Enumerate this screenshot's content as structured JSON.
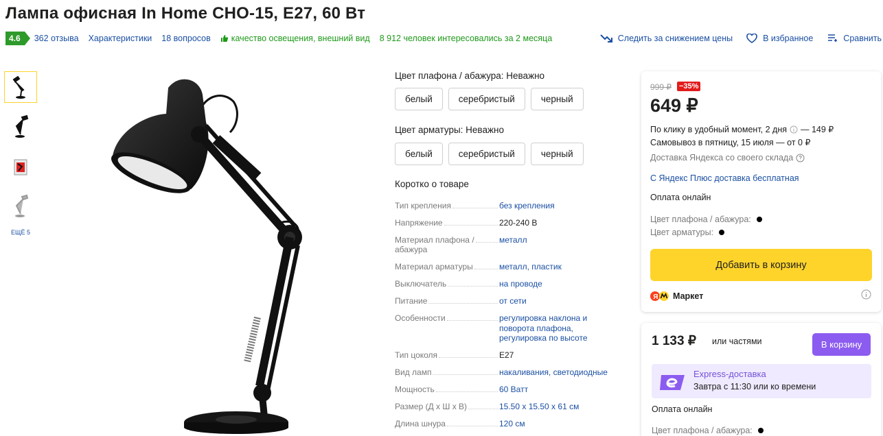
{
  "title": "Лампа офисная In Home CHO-15, E27, 60 Вт",
  "meta": {
    "rating": "4.6",
    "reviews": "362 отзыва",
    "specs_link": "Характеристики",
    "questions": "18 вопросов",
    "quality": "качество освещения, внешний вид",
    "interest": "8 912 человек интересовались за 2 месяца",
    "track_price": "Следить за снижением цены",
    "favorite": "В избранное",
    "compare": "Сравнить"
  },
  "gallery": {
    "more": "ЕЩЁ 5"
  },
  "options": {
    "shade_label": "Цвет плафона / абажура:",
    "shade_value": "Неважно",
    "shade_chips": [
      "белый",
      "серебристый",
      "черный"
    ],
    "arm_label": "Цвет арматуры:",
    "arm_value": "Неважно",
    "arm_chips": [
      "белый",
      "серебристый",
      "черный"
    ]
  },
  "specs": {
    "title": "Коротко о товаре",
    "rows": [
      {
        "key": "Тип крепления",
        "value": "без крепления"
      },
      {
        "key": "Напряжение",
        "value": "220-240 В"
      },
      {
        "key": "Материал плафона / абажура",
        "value": "металл"
      },
      {
        "key": "Материал арматуры",
        "value": "металл, пластик"
      },
      {
        "key": "Выключатель",
        "value": "на проводе"
      },
      {
        "key": "Питание",
        "value": "от сети"
      },
      {
        "key": "Особенности",
        "value": "регулировка наклона и поворота плафона, регулировка по высоте"
      },
      {
        "key": "Тип цоколя",
        "value": "E27"
      },
      {
        "key": "Вид ламп",
        "value": "накаливания, светодиодные"
      },
      {
        "key": "Мощность",
        "value": "60 Ватт"
      },
      {
        "key": "Размер (Д х Ш х В)",
        "value": "15.50 х 15.50 х 61 см"
      },
      {
        "key": "Длина шнура",
        "value": "120 см"
      }
    ]
  },
  "offer1": {
    "old_price": "999 ₽",
    "discount": "−35%",
    "price": "649 ₽",
    "delivery1": "По клику в удобный момент, 2 дня",
    "delivery1_price": "— 149 ₽",
    "pickup": "Самовывоз в пятницу, 15 июля — от 0 ₽",
    "yandex_delivery": "Доставка Яндекса со своего склада",
    "plus": "С Яндекс Плюс доставка бесплатная",
    "payment": "Оплата онлайн",
    "shade_color": "Цвет плафона / абажура:",
    "arm_color": "Цвет арматуры:",
    "add_to_cart": "Добавить в корзину",
    "seller": "Маркет"
  },
  "offer2": {
    "price": "1 133 ₽",
    "parts": "или частями",
    "buy": "В корзину",
    "express_title": "Express-доставка",
    "express_sub": "Завтра с 11:30 или ко времени",
    "payment": "Оплата онлайн",
    "shade_color": "Цвет плафона / абажура:"
  },
  "colors": {
    "rating_green": "#2e9a2a",
    "link_blue": "#1a4fa3",
    "yellow": "#fed42b",
    "purple": "#8c5cf0",
    "discount_red": "#e21b1b"
  }
}
